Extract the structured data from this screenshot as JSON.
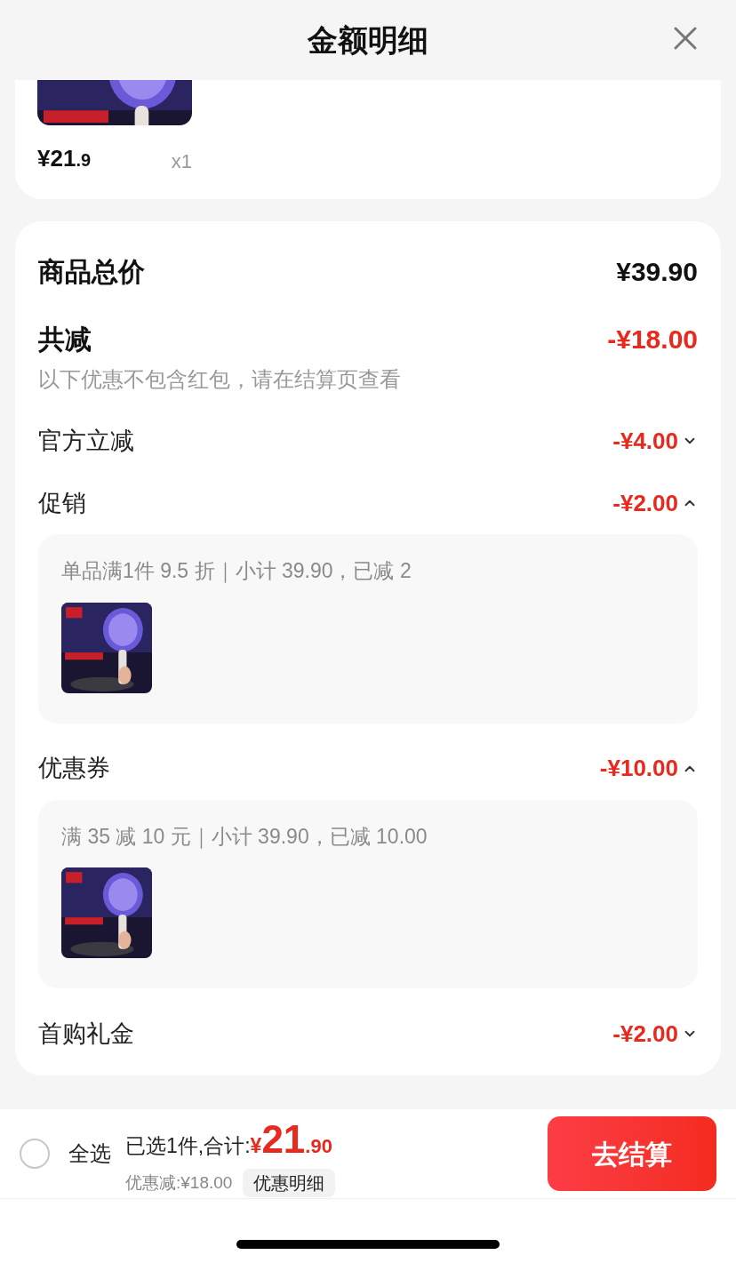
{
  "header": {
    "title": "金额明细"
  },
  "product": {
    "price_main": "¥21",
    "price_decimal": ".9",
    "quantity": "x1"
  },
  "summary": {
    "total_label": "商品总价",
    "total_value": "¥39.90",
    "reduction_label": "共减",
    "reduction_value": "-¥18.00",
    "note": "以下优惠不包含红包，请在结算页查看"
  },
  "discounts": [
    {
      "label": "官方立减",
      "amount": "-¥4.00",
      "expanded": false
    },
    {
      "label": "促销",
      "amount": "-¥2.00",
      "expanded": true,
      "detail": "单品满1件 9.5 折｜小计 39.90，已减 2"
    },
    {
      "label": "优惠券",
      "amount": "-¥10.00",
      "expanded": true,
      "detail": "满 35 减 10 元｜小计 39.90，已减 10.00"
    },
    {
      "label": "首购礼金",
      "amount": "-¥2.00",
      "expanded": false
    }
  ],
  "footer": {
    "select_all": {
      "label": "全选",
      "checked": false
    },
    "selected_text": "已选1件,合计:",
    "currency": "¥",
    "total_main": "21",
    "total_decimal": ".90",
    "discount_text": "优惠减:¥18.00",
    "details_button": "优惠明细",
    "checkout_button": "去结算"
  }
}
